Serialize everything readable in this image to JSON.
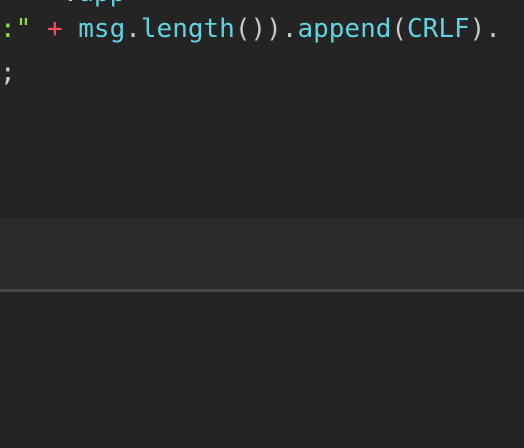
{
  "editor": {
    "line_top": {
      "tok1": "    .",
      "tok2": "app"
    },
    "line_1": {
      "t1": ":\"",
      "t2": " + ",
      "t3": "msg",
      "t4": ".",
      "t5": "length",
      "t6": "())",
      "t7": ".",
      "t8": "append",
      "t9": "(",
      "t10": "CRLF",
      "t11": ")."
    },
    "line_2": {
      "t1": ";"
    }
  },
  "colors": {
    "string": "#9bd84a",
    "operator": "#ff4d5e",
    "identifier": "#62d2e0",
    "punctuation": "#c8c8c8",
    "editor_bg": "#242424",
    "panel_bg": "#2a2a2a",
    "divider": "#454545"
  }
}
